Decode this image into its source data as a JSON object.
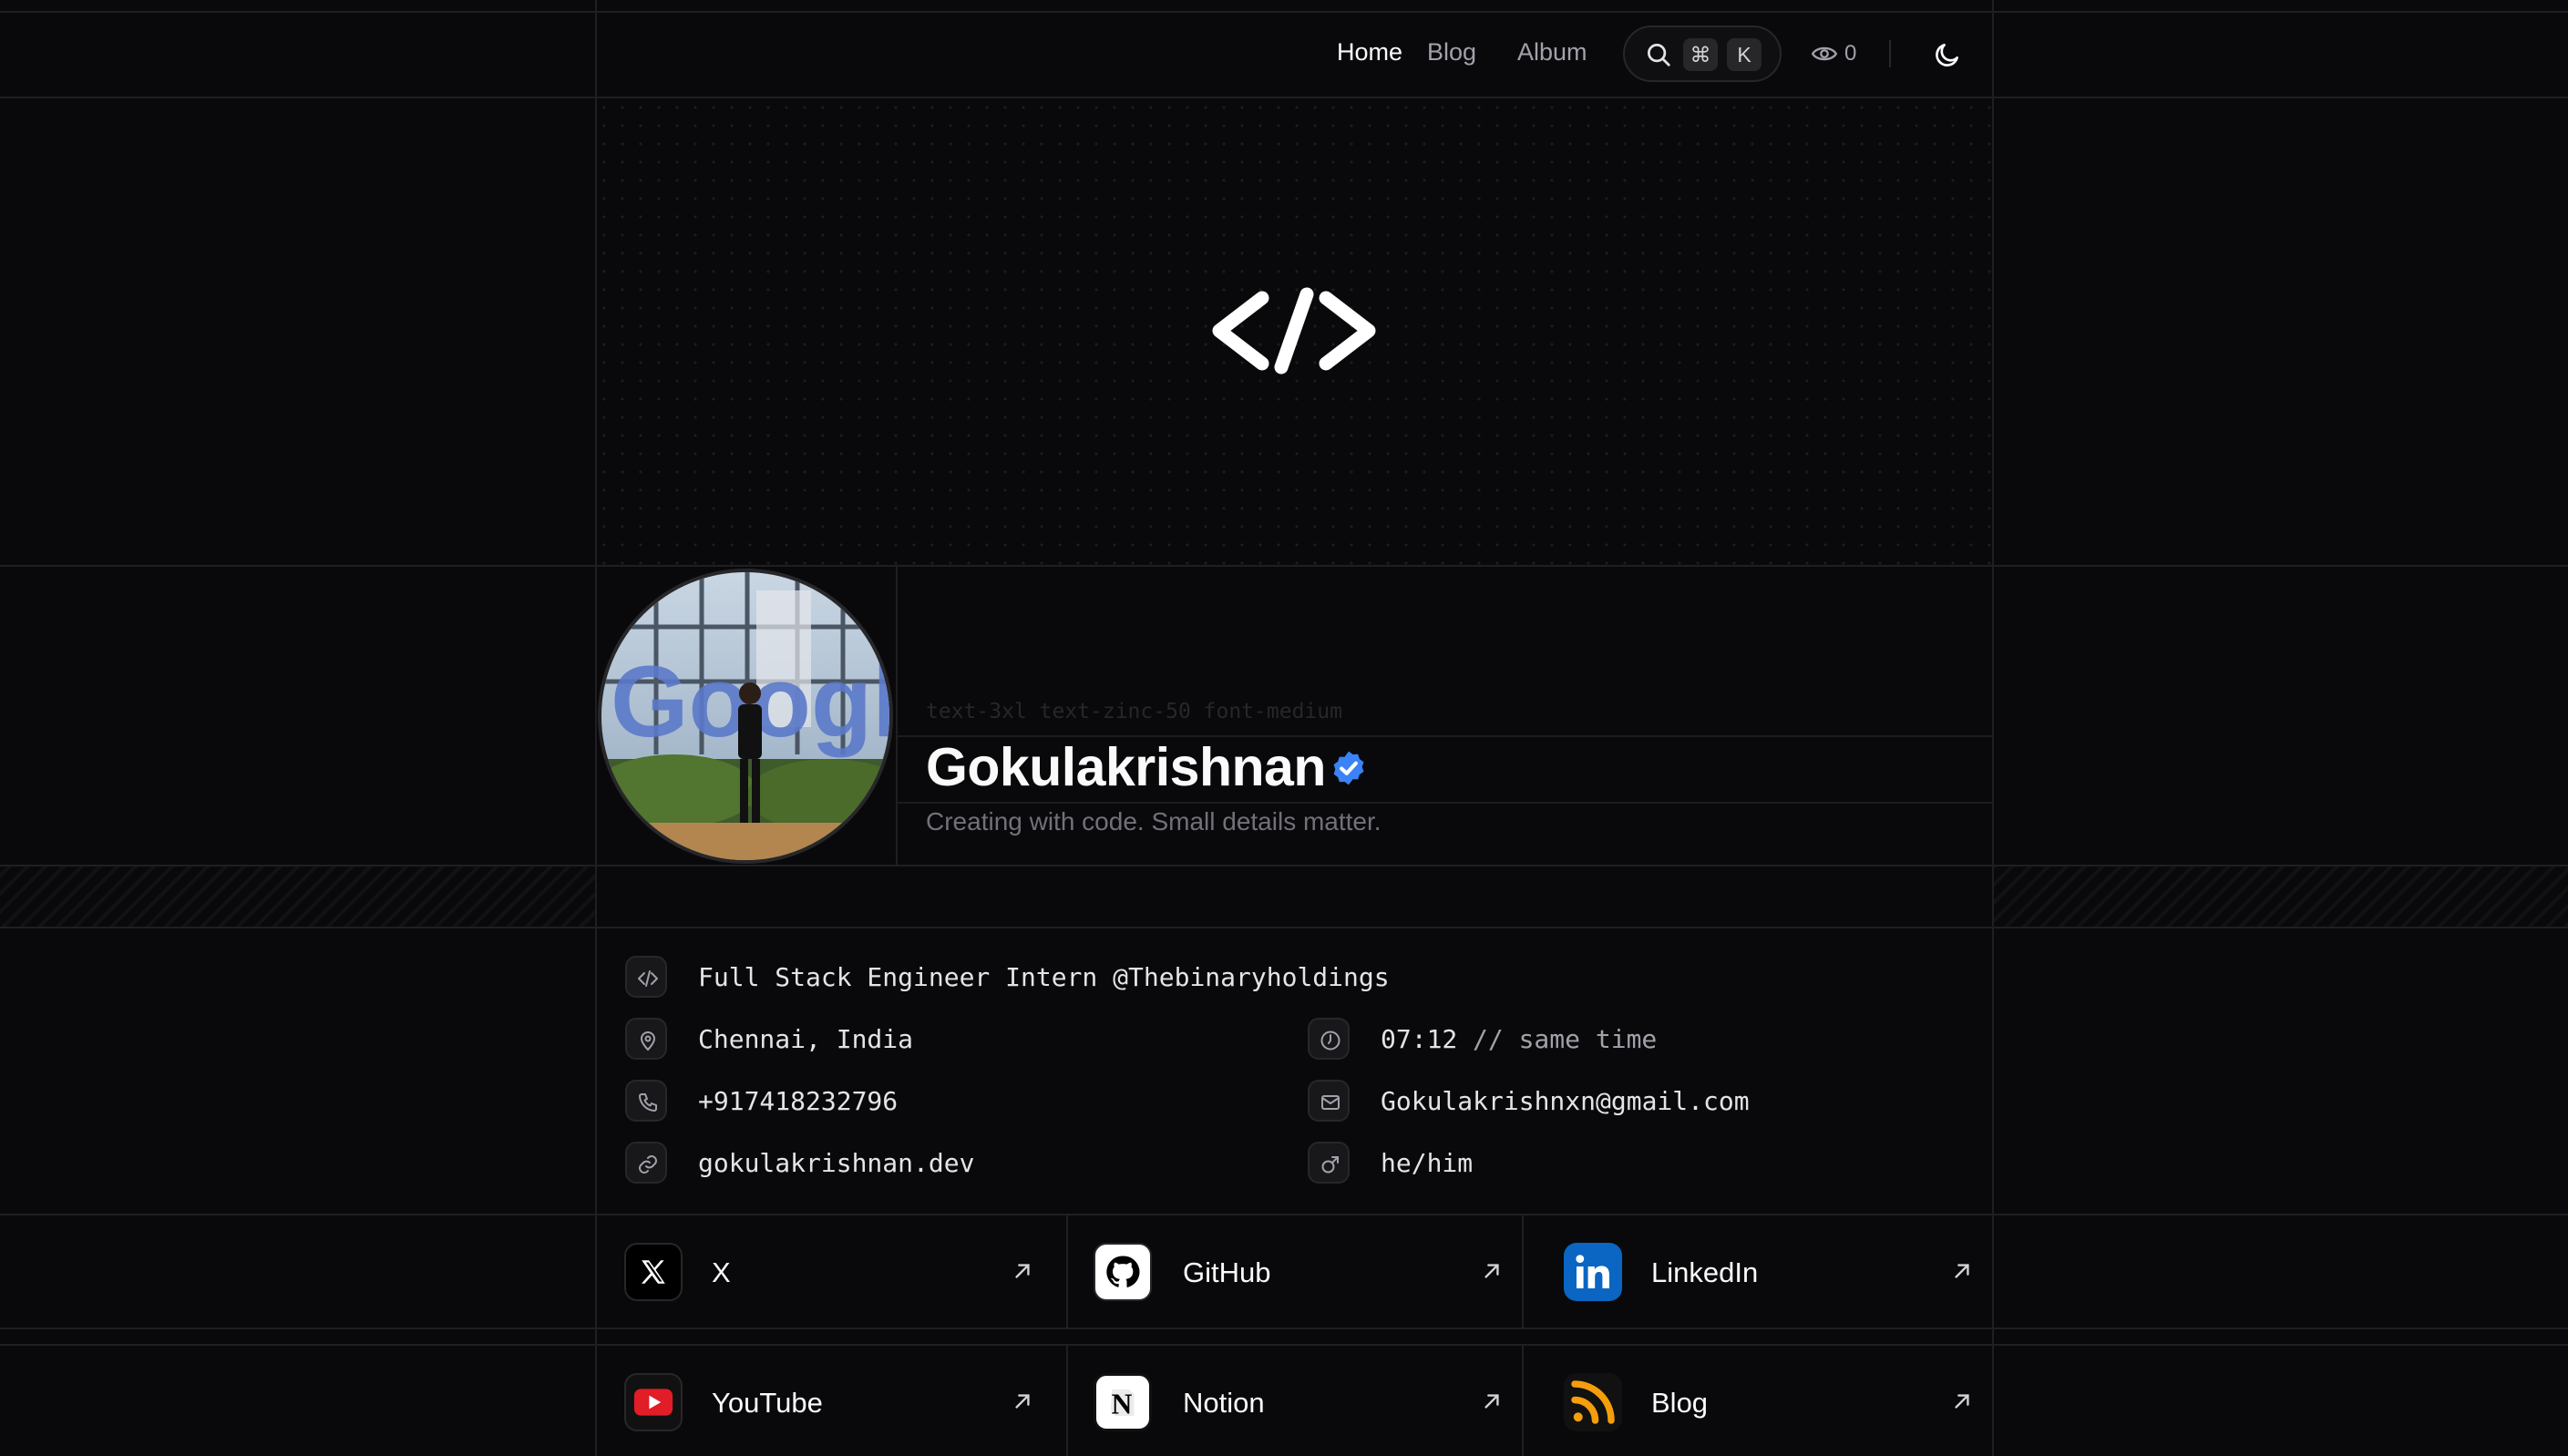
{
  "nav": {
    "links": [
      "Home",
      "Blog",
      "Album"
    ],
    "search_keys": [
      "⌘",
      "K"
    ],
    "view_count": "0"
  },
  "hero": {
    "logo_icon": "code-brackets-icon"
  },
  "profile": {
    "class_hint": "text-3xl text-zinc-50 font-medium",
    "name": "Gokulakrishnan",
    "verified_icon": "verified-badge-icon",
    "tagline": "Creating with code. Small details matter.",
    "avatar_scene": [
      "Google"
    ]
  },
  "info": {
    "role": "Full Stack Engineer Intern @Thebinaryholdings",
    "location": "Chennai, India",
    "time": "07:12",
    "time_note": "// same time",
    "phone": "+917418232796",
    "email": "Gokulakrishnxn@gmail.com",
    "website": "gokulakrishnan.dev",
    "pronouns": "he/him"
  },
  "socials": [
    {
      "label": "X",
      "icon": "x-logo-icon"
    },
    {
      "label": "GitHub",
      "icon": "github-logo-icon"
    },
    {
      "label": "LinkedIn",
      "icon": "linkedin-logo-icon"
    },
    {
      "label": "YouTube",
      "icon": "youtube-logo-icon"
    },
    {
      "label": "Notion",
      "icon": "notion-logo-icon"
    },
    {
      "label": "Blog",
      "icon": "rss-icon"
    }
  ],
  "colors": {
    "background": "#09090b",
    "border": "#1f1f23",
    "verified": "#3b82f6",
    "linkedin": "#0a66c2",
    "youtube": "#e11d28",
    "rss": "#f59e0b"
  }
}
